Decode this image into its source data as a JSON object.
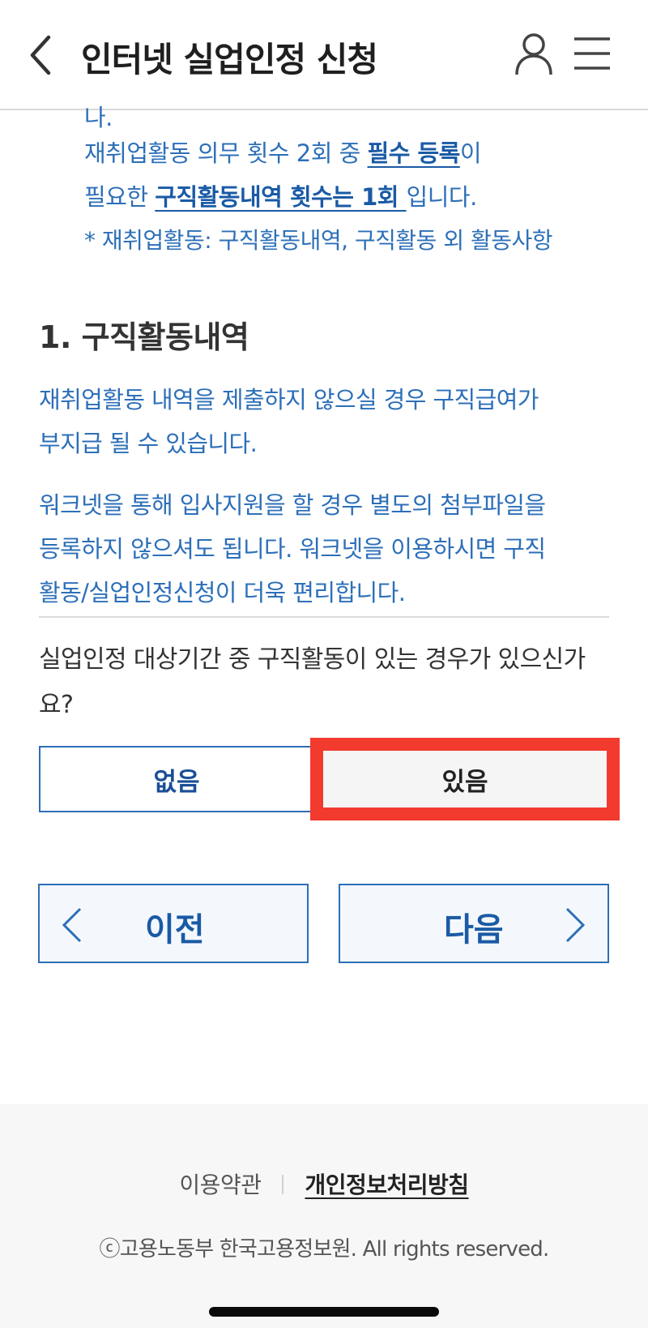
{
  "header": {
    "title": "인터넷 실업인정 신청"
  },
  "notice": {
    "line0": "나.",
    "line1_pre": "재취업활동 의무 횟수 2회 중 ",
    "line1_strong": "필수 등록",
    "line1_post": "이",
    "line2_pre": "필요한 ",
    "line2_strong": "구직활동내역 횟수는 1회 ",
    "line2_post": "입니다.",
    "line3": "* 재취업활동: 구직활동내역, 구직활동 외 활동사항"
  },
  "section": {
    "title": "1. 구직활동내역",
    "para1": [
      "재취업활동 내역을 제출하지 않으실 경우 구직급여가",
      "부지급 될 수 있습니다."
    ],
    "para2": [
      "워크넷을 통해 입사지원을 할 경우 별도의 첨부파일을",
      "등록하지 않으셔도 됩니다. 워크넷을 이용하시면 구직",
      "활동/실업인정신청이 더욱 편리합니다."
    ],
    "question": [
      "실업인정 대상기간 중 구직활동이 있는 경우가 있으신가",
      "요?"
    ]
  },
  "options": {
    "none_label": "없음",
    "yes_label": "있음"
  },
  "nav": {
    "prev_label": "이전",
    "next_label": "다음"
  },
  "footer": {
    "terms": "이용약관",
    "privacy": "개인정보처리방침",
    "copyright": "ⓒ고용노동부 한국고용정보원. All rights reserved."
  },
  "colors": {
    "accent_blue": "#2d6fb8",
    "highlight_red": "#f23a2e"
  }
}
